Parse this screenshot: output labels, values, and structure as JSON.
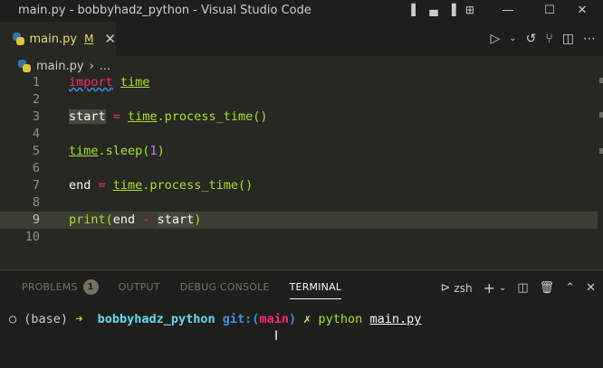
{
  "window": {
    "title": "main.py - bobbyhadz_python - Visual Studio Code",
    "controls": {
      "minimize": "—",
      "maximize": "☐",
      "close": "✕"
    }
  },
  "tab": {
    "name": "main.py",
    "modified": "M",
    "close": "✕"
  },
  "breadcrumb": {
    "file": "main.py",
    "separator": "›",
    "more": "..."
  },
  "editor": {
    "lines": [
      {
        "num": "1",
        "tokens": [
          {
            "t": "import",
            "c": "kw squiggle"
          },
          {
            "t": " ",
            "c": ""
          },
          {
            "t": "time",
            "c": "mod"
          }
        ]
      },
      {
        "num": "2",
        "tokens": []
      },
      {
        "num": "3",
        "tokens": [
          {
            "t": "start",
            "c": "hl"
          },
          {
            "t": " = ",
            "c": "op"
          },
          {
            "t": "time",
            "c": "mod"
          },
          {
            "t": ".process_time()",
            "c": "fn"
          }
        ]
      },
      {
        "num": "4",
        "tokens": []
      },
      {
        "num": "5",
        "tokens": [
          {
            "t": "time",
            "c": "mod"
          },
          {
            "t": ".sleep(",
            "c": "fn"
          },
          {
            "t": "1",
            "c": "num"
          },
          {
            "t": ")",
            "c": "fn"
          }
        ]
      },
      {
        "num": "6",
        "tokens": []
      },
      {
        "num": "7",
        "tokens": [
          {
            "t": "end",
            "c": ""
          },
          {
            "t": " = ",
            "c": "op"
          },
          {
            "t": "time",
            "c": "mod"
          },
          {
            "t": ".process_time()",
            "c": "fn"
          }
        ]
      },
      {
        "num": "8",
        "tokens": []
      },
      {
        "num": "9",
        "tokens": [
          {
            "t": "print(",
            "c": "fn"
          },
          {
            "t": "end",
            "c": ""
          },
          {
            "t": " - ",
            "c": "op"
          },
          {
            "t": "start",
            "c": "hl"
          },
          {
            "t": ")",
            "c": "fn"
          }
        ]
      },
      {
        "num": "10",
        "tokens": []
      }
    ],
    "current_line": 9
  },
  "panel": {
    "tabs": [
      {
        "label": "PROBLEMS",
        "badge": "1"
      },
      {
        "label": "OUTPUT"
      },
      {
        "label": "DEBUG CONSOLE"
      },
      {
        "label": "TERMINAL",
        "active": true
      }
    ],
    "shell": "zsh"
  },
  "terminal": {
    "circle": "○",
    "env": "(base)",
    "arrow": "➜",
    "dir": "bobbyhadz_python",
    "git_prefix": "git:(",
    "branch": "main",
    "git_suffix": ")",
    "dirty": "✗",
    "command_py": "python",
    "command_file": "main.py"
  },
  "colors": {
    "background": "#272822",
    "titlebar": "#1e1f1c",
    "accent": "#a6e22e"
  },
  "icons": [
    "layout-sidebar-left-icon",
    "layout-panel-icon",
    "layout-sidebar-right-icon",
    "customize-layout-icon",
    "run-icon",
    "chevron-down-icon",
    "timeline-icon",
    "source-control-icon",
    "split-editor-icon",
    "more-icon",
    "terminal-icon",
    "plus-icon",
    "split-terminal-icon",
    "trash-icon",
    "chevron-up-icon",
    "close-icon"
  ]
}
